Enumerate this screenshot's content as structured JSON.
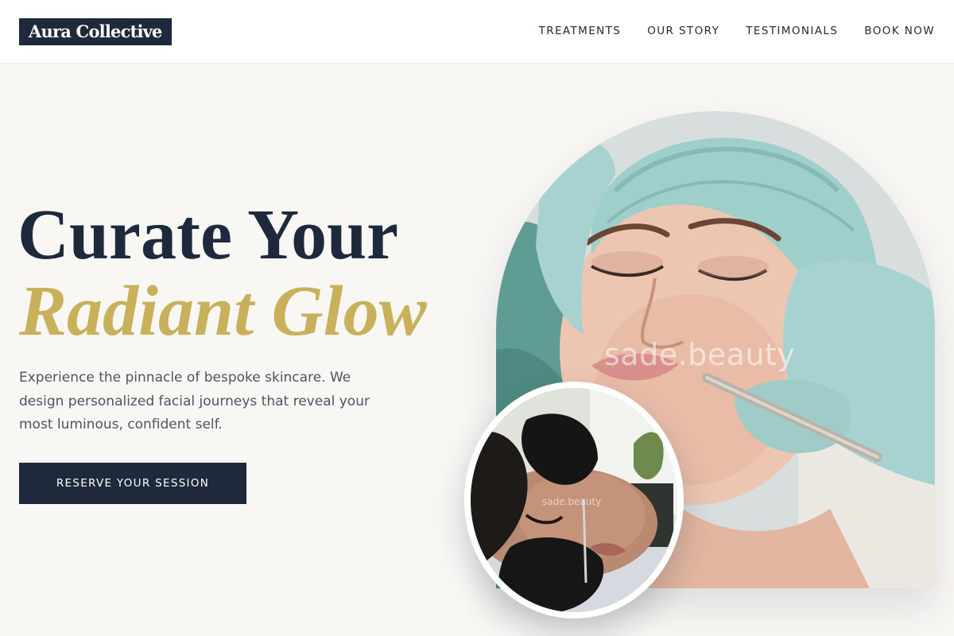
{
  "brand": {
    "name": "Aura Collective"
  },
  "nav": {
    "items": [
      {
        "label": "TREATMENTS"
      },
      {
        "label": "OUR STORY"
      },
      {
        "label": "TESTIMONIALS"
      },
      {
        "label": "BOOK NOW"
      }
    ]
  },
  "hero": {
    "headline_line1": "Curate Your",
    "headline_line2": "Radiant Glow",
    "description": "Experience the pinnacle of bespoke skincare. We design personalized facial journeys that reveal your most luminous, confident self.",
    "cta_label": "RESERVE YOUR SESSION"
  },
  "images": {
    "main_watermark": "sade.beauty",
    "inset_watermark": "sade.beauty"
  },
  "colors": {
    "navy": "#1e293b",
    "gold": "#c9b05b",
    "background": "#f8f7f4",
    "text_muted": "#4b5563"
  }
}
